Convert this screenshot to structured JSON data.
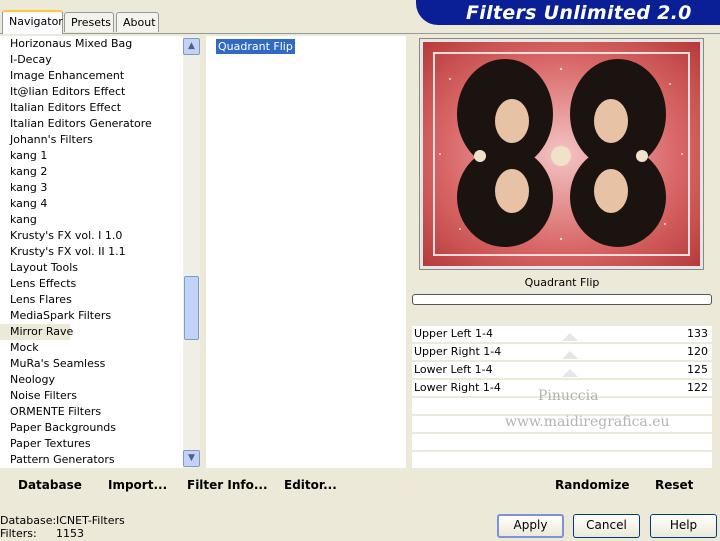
{
  "tabs": [
    {
      "label": "Navigator"
    },
    {
      "label": "Presets"
    },
    {
      "label": "About"
    }
  ],
  "banner": {
    "title": "Filters Unlimited 2.0"
  },
  "filter_list": {
    "items": [
      "Horizonaus Mixed Bag",
      "I-Decay",
      "Image Enhancement",
      "It@lian Editors Effect",
      "Italian Editors Effect",
      "Italian Editors Generatore",
      "Johann's Filters",
      "kang 1",
      "kang 2",
      "kang 3",
      "kang 4",
      "kang",
      "Krusty's FX vol. I 1.0",
      "Krusty's FX vol. II 1.1",
      "Layout Tools",
      "Lens Effects",
      "Lens Flares",
      "MediaSpark Filters",
      "Mirror Rave",
      "Mock",
      "MuRa's Seamless",
      "Neology",
      "Noise Filters",
      "ORMENTE Filters",
      "Paper Backgrounds",
      "Paper Textures",
      "Pattern Generators"
    ],
    "selected": "Mirror Rave"
  },
  "effects_list": {
    "selected": "Quadrant Flip"
  },
  "preview": {
    "title": "Quadrant Flip"
  },
  "params": [
    {
      "label": "Upper Left 1-4",
      "value": "133"
    },
    {
      "label": "Upper Right 1-4",
      "value": "120"
    },
    {
      "label": "Lower Left 1-4",
      "value": "125"
    },
    {
      "label": "Lower Right 1-4",
      "value": "122"
    }
  ],
  "toolbar": {
    "database": "Database",
    "import": "Import...",
    "filter_info": "Filter Info...",
    "editor": "Editor...",
    "randomize": "Randomize",
    "reset": "Reset"
  },
  "status": {
    "database_label": "Database:",
    "database_value": "ICNET-Filters",
    "filters_label": "Filters:",
    "filters_value": "1153"
  },
  "buttons": {
    "apply": "Apply",
    "cancel": "Cancel",
    "help": "Help"
  },
  "watermark": {
    "line1": "Pinuccia",
    "line2": "www.maidiregrafica.eu"
  },
  "colors": {
    "banner": "#0a1e96",
    "selection": "#316ac5",
    "preview_frame": "#d95a5a"
  }
}
